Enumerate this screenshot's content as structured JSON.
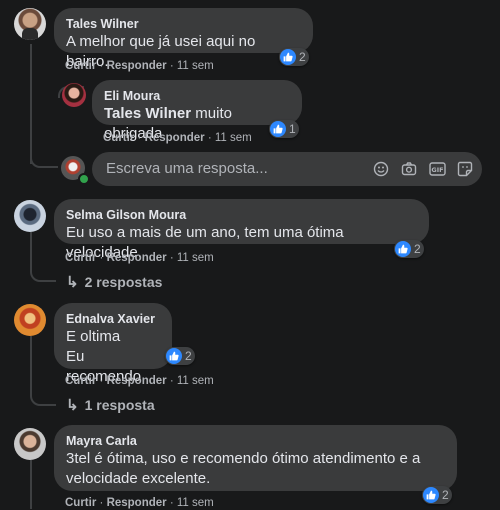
{
  "actions": {
    "like": "Curtir",
    "reply": "Responder",
    "sep": "·"
  },
  "comments": [
    {
      "author": "Tales Wilner",
      "text": "A melhor que já usei aqui no bairro.",
      "time": "11 sem",
      "reactions": "2"
    },
    {
      "author": "Eli Moura",
      "mention": "Tales Wilner",
      "text": " muito obrigada",
      "time": "11 sem",
      "reactions": "1"
    },
    {
      "author": "Selma Gilson Moura",
      "text": "Eu uso a mais de um ano, tem uma ótima velocidade.",
      "time": "11 sem",
      "reactions": "2",
      "replies": "2 respostas"
    },
    {
      "author": "Ednalva Xavier",
      "lines": [
        "E oltima",
        "Eu recomendo"
      ],
      "time": "11 sem",
      "reactions": "2",
      "replies": "1 resposta"
    },
    {
      "author": "Mayra Carla",
      "lines": [
        "3tel é ótima, uso e recomendo ótimo atendimento e a",
        "velocidade excelente."
      ],
      "time": "11 sem",
      "reactions": "2"
    }
  ],
  "reply_box": {
    "placeholder": "Escreva uma resposta..."
  },
  "icons": [
    "emoji-icon",
    "camera-icon",
    "gif-icon",
    "sticker-icon",
    "like-icon",
    "reply-arrow-icon"
  ],
  "colors": {
    "background": "#18191a",
    "bubble": "#3a3b3c",
    "like": "#2d88ff",
    "text": "#e4e6eb",
    "muted": "#b0b3b8"
  }
}
